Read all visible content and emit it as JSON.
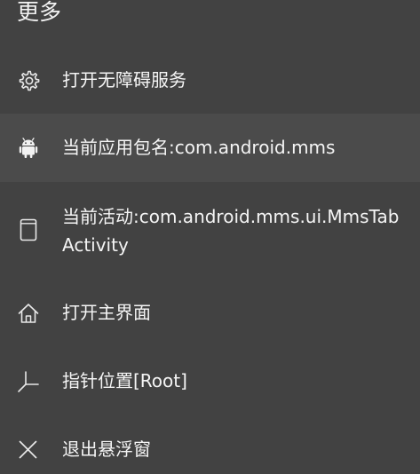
{
  "header": {
    "title": "更多"
  },
  "menu": {
    "items": [
      {
        "label": "打开无障碍服务",
        "icon": "gear-icon"
      },
      {
        "label": "当前应用包名:com.android.mms",
        "icon": "android-icon"
      },
      {
        "label": "当前活动:com.android.mms.ui.MmsTabActivity",
        "icon": "tablet-icon"
      },
      {
        "label": "打开主界面",
        "icon": "home-icon"
      },
      {
        "label": "指针位置[Root]",
        "icon": "pointer-location-icon"
      },
      {
        "label": "退出悬浮窗",
        "icon": "close-icon"
      }
    ]
  },
  "colors": {
    "background": "#424242",
    "highlight": "#4b4b4b",
    "text": "#f5f5f5"
  }
}
